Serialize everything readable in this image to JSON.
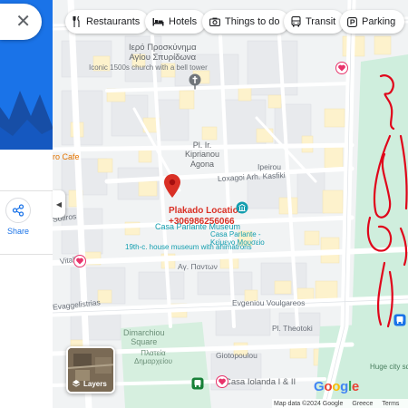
{
  "search": {
    "close_icon": "close-icon"
  },
  "chips": [
    {
      "label": "Restaurants",
      "icon": "fork-knife-icon"
    },
    {
      "label": "Hotels",
      "icon": "bed-icon"
    },
    {
      "label": "Things to do",
      "icon": "camera-icon"
    },
    {
      "label": "Transit",
      "icon": "bus-icon"
    },
    {
      "label": "Parking",
      "icon": "parking-icon"
    }
  ],
  "side_panel": {
    "share_label": "Share",
    "collapse_icon": "chevron-left-icon",
    "hero_color": "#1a73e8"
  },
  "map": {
    "pin_label": "Plakado Location",
    "pin_phone": "+306986256066",
    "museum_name": "Casa Parlante Museum",
    "museum_greek": "Casa Parlante -\nΚείμενο Μουσείο",
    "museum_desc": "19th-c. house museum with animatrons",
    "church_greek": "Ιερό Προσκύνημα\nΑγίου Σπυρίδωνα",
    "church_desc": "Iconic 1500s church with a bell tower",
    "square_kiprianou": "Pl. Ir.\nKiprianou\nAgona",
    "cafe": "ro Cafe",
    "streets": {
      "loxagoi": "Loxagoi Arh. Kasfiki",
      "ipeirou": "Ipeirou",
      "sotiros": "Sotiros",
      "ag_pantwn": "Αγ. Παντων",
      "evgeniou": "Evgeniou Voulgareos",
      "theotoki": "Pl. Theotoki",
      "vitali": "Vitali",
      "evaggelistrias": "Evaggelistrias",
      "giotopoulou": "Giotopoulou"
    },
    "dimarchiou": "Dimarchiou\nSquare",
    "dimarchiou_greek": "Πλατεία\nΔημαρχείου",
    "hotel": "Casa Iolanda I & II",
    "huge_city": "Huge city sq",
    "layers_label": "Layers",
    "google": [
      "G",
      "o",
      "o",
      "g",
      "l",
      "e"
    ],
    "google_colors": [
      "#4285f4",
      "#ea4335",
      "#fbbc05",
      "#4285f4",
      "#34a853",
      "#ea4335"
    ],
    "footer": {
      "data": "Map data ©2024 Google",
      "country": "Greece",
      "terms": "Terms"
    }
  },
  "colors": {
    "park": "#cfeedd",
    "pin_red": "#d93025",
    "teal": "#129eaf",
    "heart": "#e8336b",
    "scribble": "#e0061b"
  }
}
